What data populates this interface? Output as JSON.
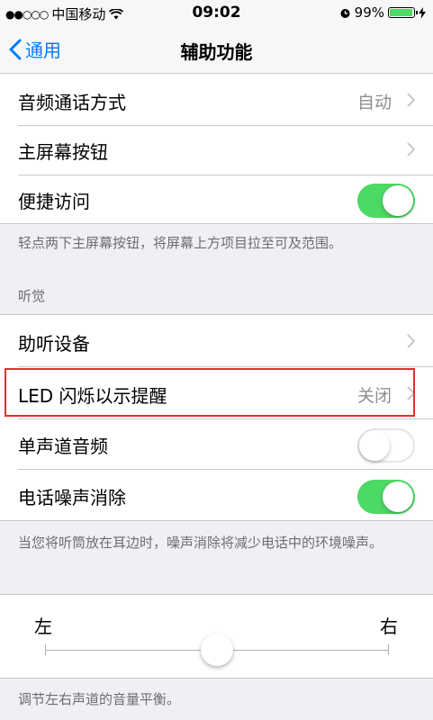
{
  "status_bar": {
    "signal": "●●○○○",
    "carrier": "中国移动",
    "time": "09:02",
    "battery": "99%",
    "battery_level": 0.99
  },
  "nav": {
    "back_label": "通用",
    "title": "辅助功能"
  },
  "rows": {
    "audio_call": {
      "label": "音频通话方式",
      "value": "自动"
    },
    "home_button": {
      "label": "主屏幕按钮"
    },
    "reachability": {
      "label": "便捷访问",
      "on": true
    },
    "hearing_devices": {
      "label": "助听设备"
    },
    "led_flash": {
      "label": "LED 闪烁以示提醒",
      "value": "关闭"
    },
    "mono_audio": {
      "label": "单声道音频",
      "on": false
    },
    "noise_cancel": {
      "label": "电话噪声消除",
      "on": true
    }
  },
  "footnotes": {
    "reachability": "轻点两下主屏幕按钮，将屏幕上方项目拉至可及范围。",
    "noise_cancel": "当您将听筒放在耳边时，噪声消除将减少电话中的环境噪声。",
    "balance": "调节左右声道的音量平衡。"
  },
  "section_headers": {
    "hearing": "听觉"
  },
  "balance": {
    "left_label": "左",
    "right_label": "右",
    "value": 0.5
  },
  "colors": {
    "accent": "#007aff",
    "toggle_on": "#4cd964",
    "highlight": "#e0302f"
  }
}
